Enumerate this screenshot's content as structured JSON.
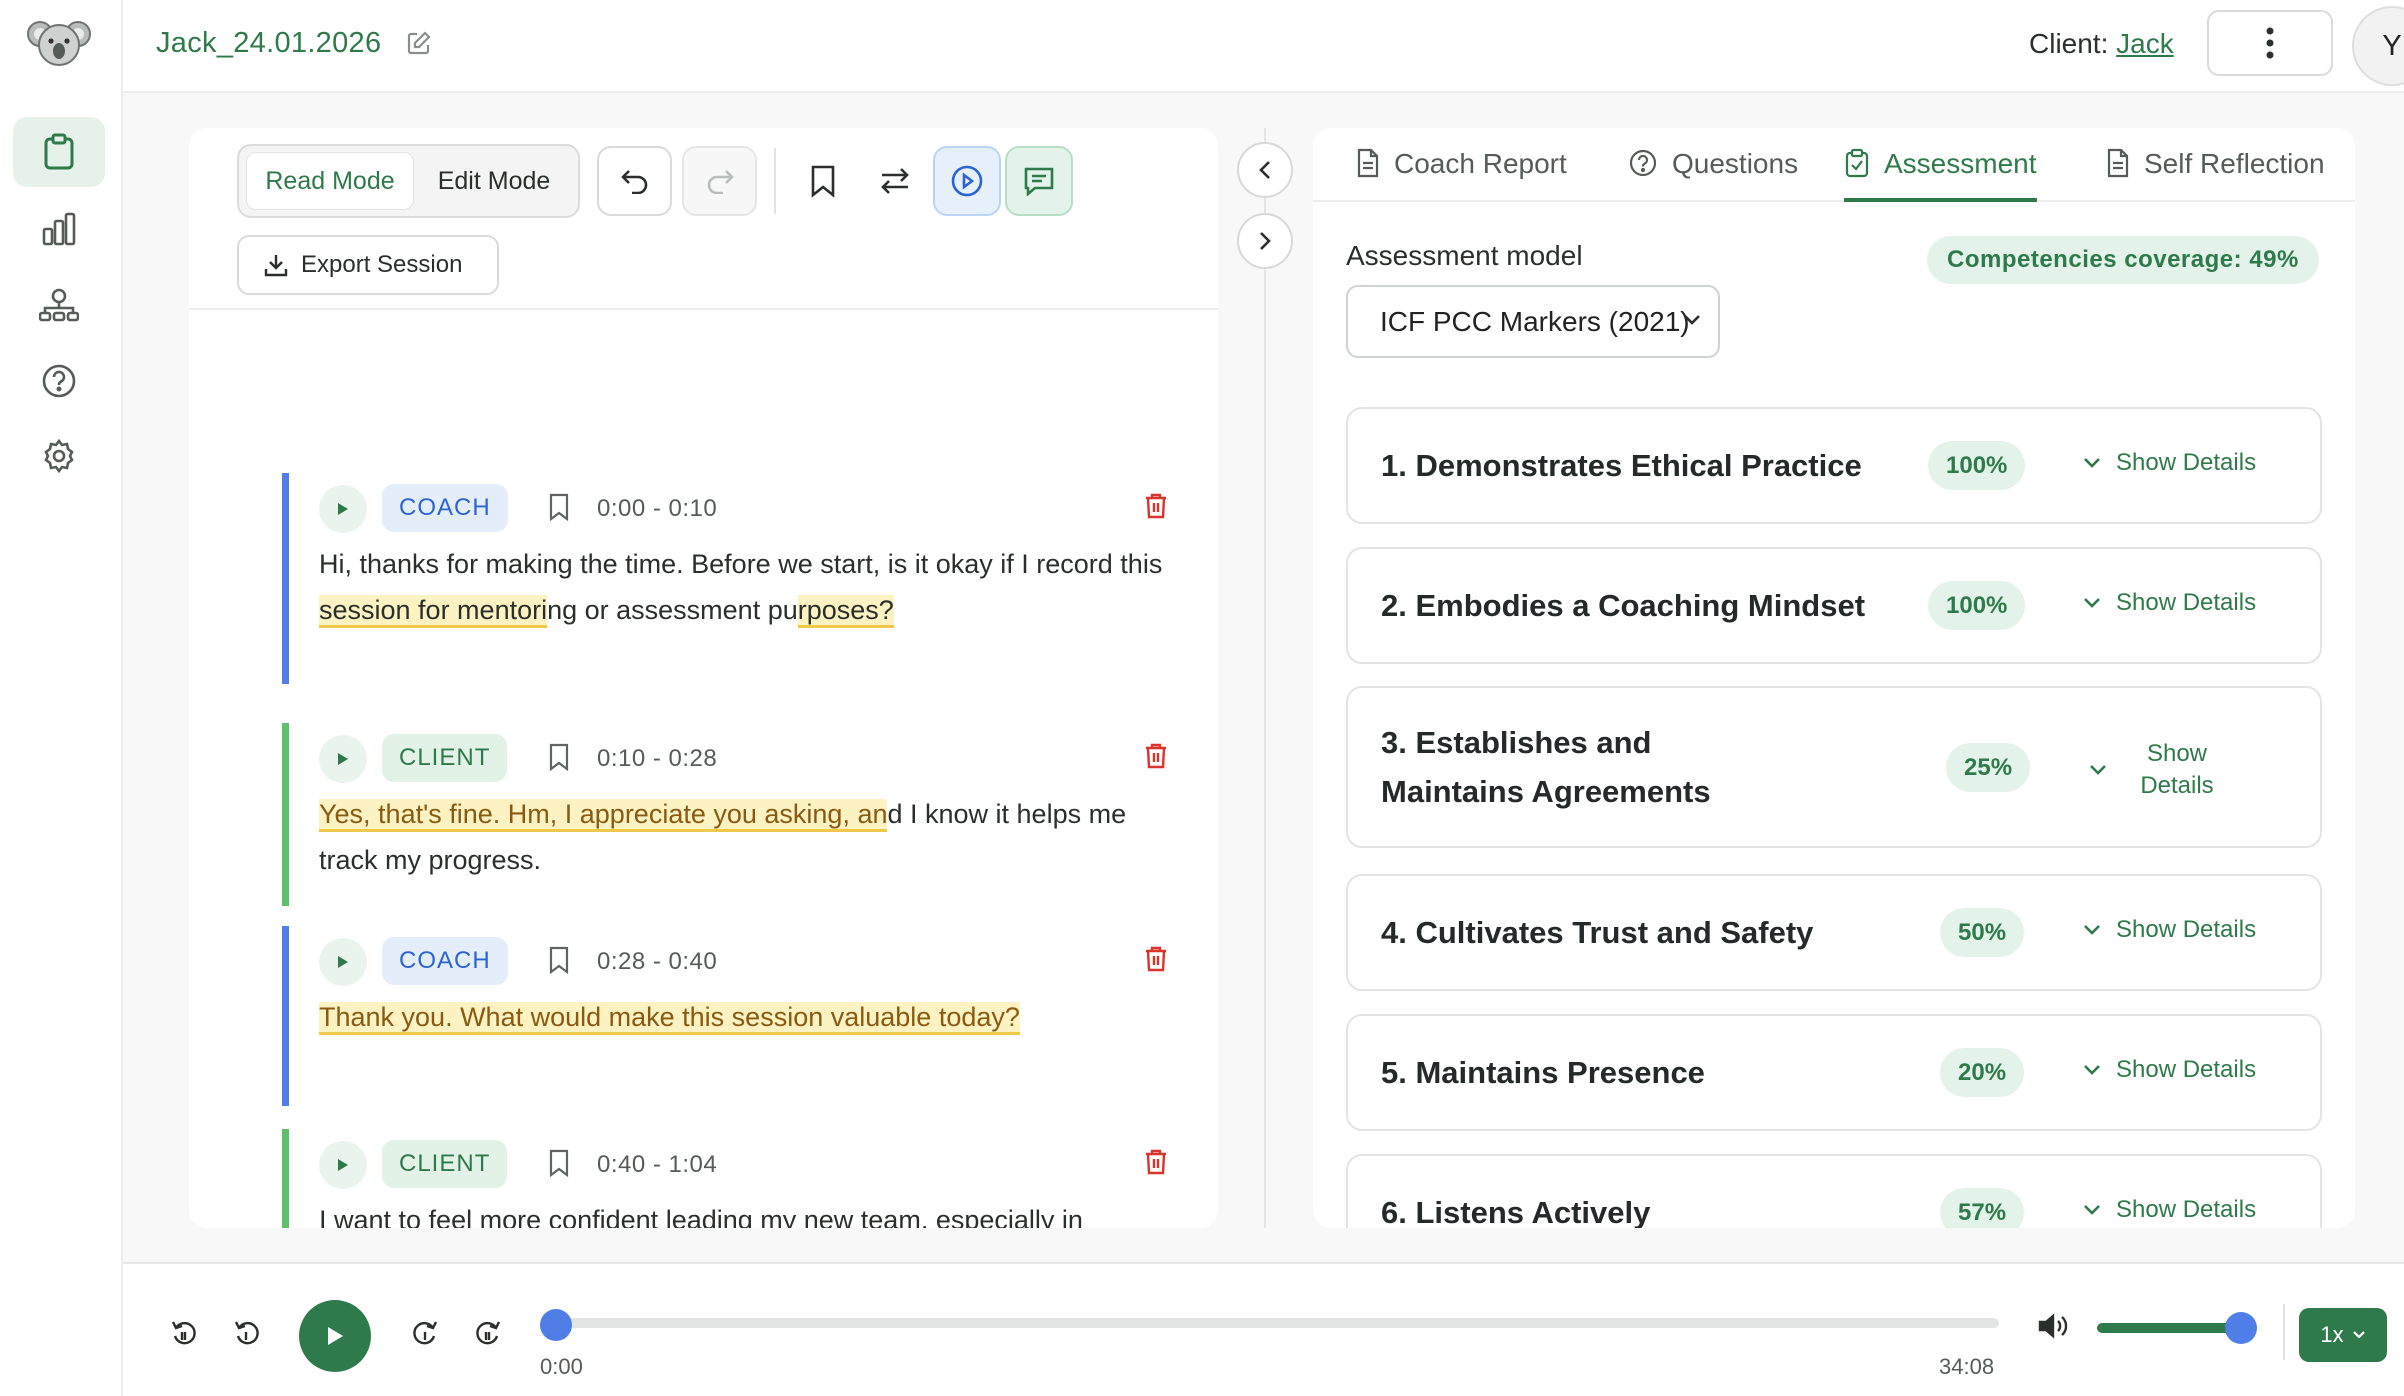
{
  "app": {
    "session_title": "Jack_24.01.2026",
    "client_prefix": "Client:",
    "client_name": "Jack",
    "avatar_initial": "Y"
  },
  "sidebar": {
    "items": [
      {
        "icon": "clipboard-icon",
        "active": true
      },
      {
        "icon": "bar-chart-icon",
        "active": false
      },
      {
        "icon": "team-icon",
        "active": false
      },
      {
        "icon": "help-icon",
        "active": false
      },
      {
        "icon": "gear-icon",
        "active": false
      }
    ]
  },
  "toolbar": {
    "read_mode": "Read Mode",
    "edit_mode": "Edit Mode",
    "export_label": "Export Session"
  },
  "transcript": {
    "segments": [
      {
        "speaker": "COACH",
        "time": "0:00 - 0:10",
        "text_parts": [
          "Hi, thanks for making the time. Before we start, is it okay if I record this ",
          "session for mentori",
          "ng or assessment pu",
          "rposes?"
        ]
      },
      {
        "speaker": "CLIENT",
        "time": "0:10 - 0:28",
        "text_parts": [
          "Yes, that's fine. Hm, I appreciate you asking, an",
          "d I know it helps me track my progress."
        ]
      },
      {
        "speaker": "COACH",
        "time": "0:28 - 0:40",
        "text_parts": [
          "Thank you. What would make this session valuable today?"
        ]
      },
      {
        "speaker": "CLIENT",
        "time": "0:40 - 1:04",
        "text_parts": [
          "I want to feel more confident leading my new team, especially in meetings where decisions get messy and I hold back or second-guess myself."
        ]
      }
    ]
  },
  "right_panel": {
    "tabs": [
      {
        "label": "Coach Report",
        "icon": "document-icon",
        "active": false
      },
      {
        "label": "Questions",
        "icon": "question-circle-icon",
        "active": false
      },
      {
        "label": "Assessment",
        "icon": "clipboard-check-icon",
        "active": true
      },
      {
        "label": "Self Reflection",
        "icon": "document-icon",
        "active": false
      }
    ],
    "model_label": "Assessment model",
    "model_value": "ICF PCC Markers (2021)",
    "coverage": "Competencies coverage: 49%",
    "competencies": [
      {
        "title": "1. Demonstrates Ethical Practice",
        "percent": "100%",
        "details": "Show Details"
      },
      {
        "title": "2. Embodies a Coaching Mindset",
        "percent": "100%",
        "details": "Show Details"
      },
      {
        "title": "3. Establishes and Maintains Agreements",
        "percent": "25%",
        "details": "Show Details"
      },
      {
        "title": "4. Cultivates Trust and Safety",
        "percent": "50%",
        "details": "Show Details"
      },
      {
        "title": "5. Maintains Presence",
        "percent": "20%",
        "details": "Show Details"
      },
      {
        "title": "6. Listens Actively",
        "percent": "57%",
        "details": "Show Details"
      }
    ]
  },
  "player": {
    "current_time": "0:00",
    "duration": "34:08",
    "progress": 0,
    "volume": 1.0,
    "speed": "1x"
  },
  "colors": {
    "brand": "#2f7a4b",
    "coach": "#4f7fe6",
    "client": "#5fbf6a",
    "highlight": "#fcf2c2"
  }
}
